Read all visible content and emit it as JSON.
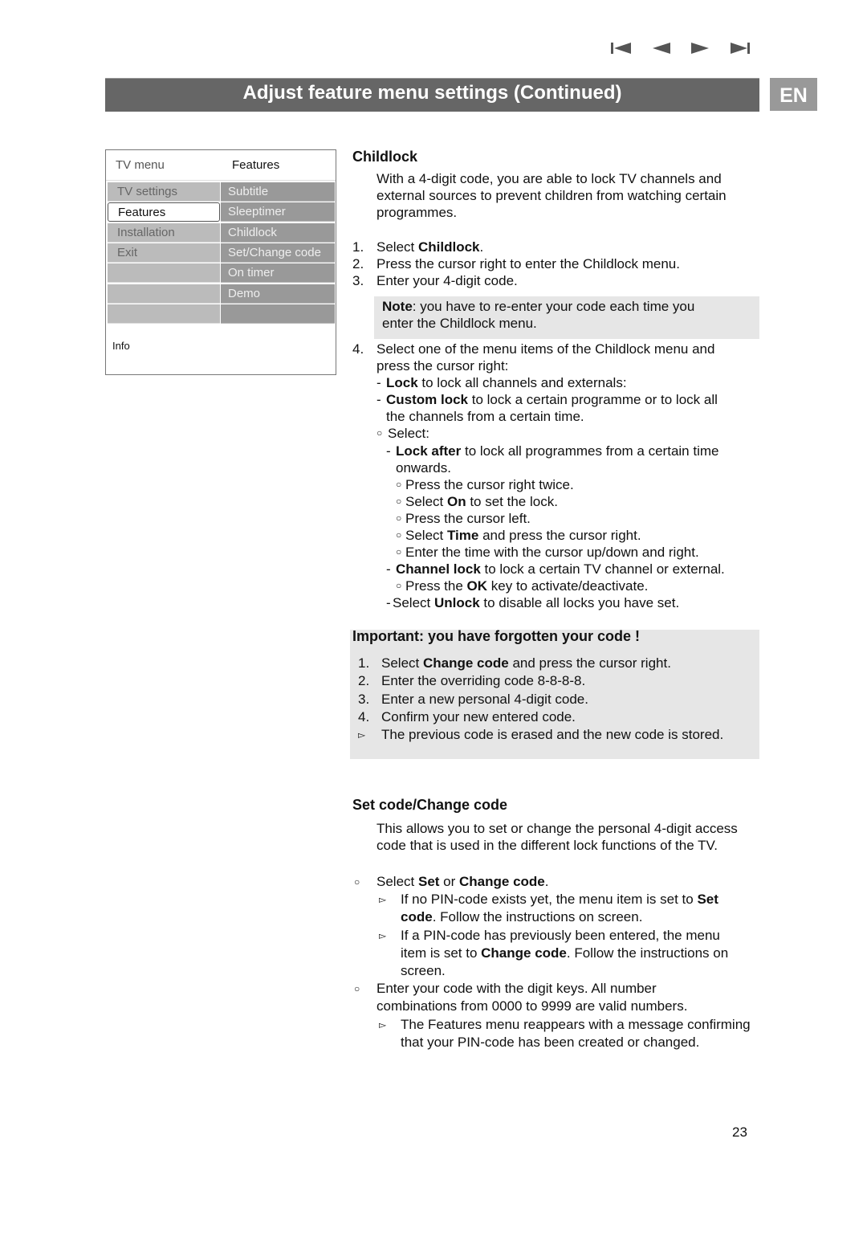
{
  "nav_icons": [
    "skip-back-icon",
    "previous-icon",
    "next-icon",
    "skip-forward-icon"
  ],
  "header": {
    "title": "Adjust feature menu settings  (Continued)",
    "language": "EN"
  },
  "tv_menu": {
    "title": "TV menu",
    "submenu_title": "Features",
    "left_items": [
      {
        "label": "TV settings"
      },
      {
        "label": "Features",
        "selected": true
      },
      {
        "label": "Installation"
      },
      {
        "label": "Exit"
      },
      {
        "label": ""
      },
      {
        "label": ""
      },
      {
        "label": ""
      }
    ],
    "right_items": [
      "Subtitle",
      "Sleeptimer",
      "Childlock",
      "Set/Change code",
      "On timer",
      "Demo",
      ""
    ],
    "info_label": "Info"
  },
  "sections": {
    "childlock_heading": "Childlock",
    "childlock_intro": [
      {
        "level": "para",
        "lines": [
          [
            [
              "With a 4-digit code, you are able to lock TV channels and",
              0
            ]
          ],
          [
            [
              "external sources to prevent children from watching certain",
              0
            ]
          ],
          [
            [
              "programmes.",
              0
            ]
          ]
        ]
      }
    ],
    "childlock_steps": [
      {
        "marker": "1.",
        "level": "step",
        "lines": [
          [
            [
              "Select ",
              0
            ],
            [
              "Childlock",
              1
            ],
            [
              ".",
              0
            ]
          ]
        ]
      },
      {
        "marker": "2.",
        "level": "step",
        "lines": [
          [
            [
              "Press the cursor right to enter the Childlock menu.",
              0
            ]
          ]
        ]
      },
      {
        "marker": "3.",
        "level": "step",
        "lines": [
          [
            [
              "Enter your 4-digit code.",
              0
            ]
          ]
        ]
      }
    ],
    "note": [
      {
        "level": "note",
        "lines": [
          [
            [
              "Note",
              1
            ],
            [
              ": you have to re-enter your code each time you",
              0
            ]
          ],
          [
            [
              "enter the Childlock menu.",
              0
            ]
          ]
        ]
      }
    ],
    "childlock_step4": [
      {
        "marker": "4.",
        "level": "step",
        "lines": [
          [
            [
              "Select one of the menu items of the Childlock menu and",
              0
            ]
          ],
          [
            [
              "press the cursor right:",
              0
            ]
          ]
        ]
      },
      {
        "marker": "-",
        "level": "dash1",
        "lines": [
          [
            [
              "Lock",
              1
            ],
            [
              " to lock all channels and externals:",
              0
            ]
          ]
        ]
      },
      {
        "marker": "-",
        "level": "dash1",
        "lines": [
          [
            [
              "Custom lock",
              1
            ],
            [
              " to lock a certain programme or to lock all",
              0
            ]
          ],
          [
            [
              "the channels from a certain time.",
              0
            ]
          ]
        ]
      },
      {
        "marker": "○",
        "level": "circ1",
        "lines": [
          [
            [
              "Select:",
              0
            ]
          ]
        ]
      },
      {
        "marker": "-",
        "level": "dash2",
        "lines": [
          [
            [
              "Lock after",
              1
            ],
            [
              " to lock all programmes from a certain time",
              0
            ]
          ],
          [
            [
              "onwards.",
              0
            ]
          ]
        ]
      },
      {
        "marker": "○",
        "level": "circ2",
        "lines": [
          [
            [
              "Press the cursor right twice.",
              0
            ]
          ]
        ]
      },
      {
        "marker": "○",
        "level": "circ2",
        "lines": [
          [
            [
              "Select ",
              0
            ],
            [
              "On",
              1
            ],
            [
              " to set the lock.",
              0
            ]
          ]
        ]
      },
      {
        "marker": "○",
        "level": "circ2",
        "lines": [
          [
            [
              "Press the cursor left.",
              0
            ]
          ]
        ]
      },
      {
        "marker": "○",
        "level": "circ2",
        "lines": [
          [
            [
              "Select ",
              0
            ],
            [
              "Time",
              1
            ],
            [
              " and press the cursor right.",
              0
            ]
          ]
        ]
      },
      {
        "marker": "○",
        "level": "circ2",
        "lines": [
          [
            [
              "Enter the time with the cursor up/down and right.",
              0
            ]
          ]
        ]
      },
      {
        "marker": "-",
        "level": "dash2",
        "lines": [
          [
            [
              "Channel lock",
              1
            ],
            [
              " to lock a certain TV channel or external.",
              0
            ]
          ]
        ]
      },
      {
        "marker": "○",
        "level": "circ2",
        "lines": [
          [
            [
              "Press the ",
              0
            ],
            [
              "OK",
              1
            ],
            [
              " key to activate/deactivate.",
              0
            ]
          ]
        ]
      },
      {
        "marker": "-",
        "level": "dash3",
        "lines": [
          [
            [
              "Select ",
              0
            ],
            [
              "Unlock",
              1
            ],
            [
              " to disable all locks you have set.",
              0
            ]
          ]
        ]
      }
    ],
    "important_heading": "Important: you have forgotten your code !",
    "important_steps": [
      {
        "marker": "1.",
        "level": "imp",
        "lines": [
          [
            [
              "Select ",
              0
            ],
            [
              "Change code",
              1
            ],
            [
              " and press the cursor right.",
              0
            ]
          ]
        ]
      },
      {
        "marker": "2.",
        "level": "imp",
        "lines": [
          [
            [
              "Enter the overriding code 8-8-8-8.",
              0
            ]
          ]
        ]
      },
      {
        "marker": "3.",
        "level": "imp",
        "lines": [
          [
            [
              "Enter a new personal 4-digit code.",
              0
            ]
          ]
        ]
      },
      {
        "marker": "4.",
        "level": "imp",
        "lines": [
          [
            [
              "Confirm your new entered code.",
              0
            ]
          ]
        ]
      },
      {
        "marker": "▻",
        "level": "imp",
        "lines": [
          [
            [
              "The previous code is erased and the new code is stored.",
              0
            ]
          ]
        ]
      }
    ],
    "setcode_heading": "Set code/Change code",
    "setcode_intro": [
      {
        "level": "para",
        "lines": [
          [
            [
              "This allows you to set or change the personal 4-digit access",
              0
            ]
          ],
          [
            [
              "code that is used in the different lock functions of the TV.",
              0
            ]
          ]
        ]
      }
    ],
    "setcode_steps": [
      {
        "marker": "○",
        "level": "sc1",
        "lines": [
          [
            [
              "Select ",
              0
            ],
            [
              "Set",
              1
            ],
            [
              " or ",
              0
            ],
            [
              "Change code",
              1
            ],
            [
              ".",
              0
            ]
          ]
        ]
      },
      {
        "marker": "▻",
        "level": "sc2",
        "lines": [
          [
            [
              "If no PIN-code exists yet, the menu item is set to ",
              0
            ],
            [
              "Set",
              1
            ]
          ],
          [
            [
              "code",
              1
            ],
            [
              ". Follow the instructions on screen.",
              0
            ]
          ]
        ]
      },
      {
        "marker": "▻",
        "level": "sc2",
        "lines": [
          [
            [
              "If a PIN-code has previously been entered, the menu",
              0
            ]
          ],
          [
            [
              "item is set to ",
              0
            ],
            [
              "Change code",
              1
            ],
            [
              ". Follow the instructions on",
              0
            ]
          ],
          [
            [
              "screen.",
              0
            ]
          ]
        ]
      },
      {
        "marker": "○",
        "level": "sc1",
        "lines": [
          [
            [
              "Enter your code with the digit keys. All number",
              0
            ]
          ],
          [
            [
              "combinations from 0000 to 9999 are valid numbers.",
              0
            ]
          ]
        ]
      },
      {
        "marker": "▻",
        "level": "sc2",
        "lines": [
          [
            [
              "The Features menu reappears with a message confirming",
              0
            ]
          ],
          [
            [
              "that your PIN-code has been created or changed.",
              0
            ]
          ]
        ]
      }
    ]
  },
  "page_number": "23"
}
